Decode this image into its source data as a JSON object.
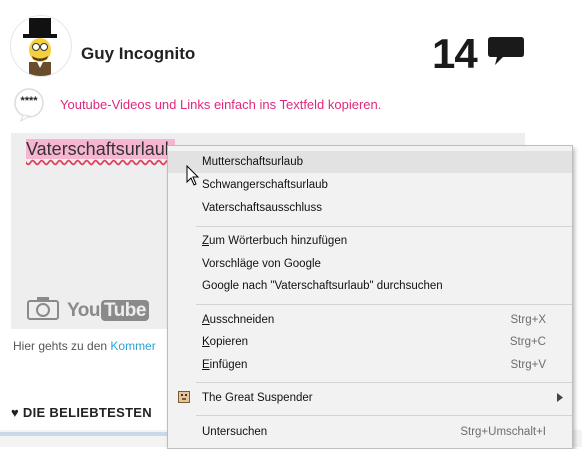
{
  "profile": {
    "username": "Guy Incognito",
    "comment_count": "14",
    "avatar_icon": "cartoon-avatar-top-hat"
  },
  "hint": {
    "stars": "****",
    "text": "Youtube-Videos und Links einfach ins Textfeld kopieren."
  },
  "editor": {
    "value": "Vaterschaftsurlaub"
  },
  "toolbar": {
    "camera_icon": "camera-icon",
    "youtube_word": "You",
    "youtube_tube": "Tube"
  },
  "footer": {
    "prefix": "Hier gehts zu den ",
    "link": "Kommer"
  },
  "popular": {
    "heading": "♥ DIE BELIEBTESTEN"
  },
  "context_menu": {
    "suggestions": [
      "Mutterschaftsurlaub",
      "Schwangerschaftsurlaub",
      "Vaterschaftsausschluss"
    ],
    "dictionary": "Zum Wörterbuch hinzufügen",
    "google_suggestions": "Vorschläge von Google",
    "google_search": "Google nach \"Vaterschaftsurlaub\" durchsuchen",
    "cut": "Ausschneiden",
    "cut_shortcut": "Strg+X",
    "copy": "Kopieren",
    "copy_shortcut": "Strg+C",
    "paste": "Einfügen",
    "paste_shortcut": "Strg+V",
    "extension": "The Great Suspender",
    "inspect": "Untersuchen",
    "inspect_shortcut": "Strg+Umschalt+I"
  },
  "colors": {
    "hint_text": "#e0287d",
    "link": "#2aa3d6",
    "spell_highlight": "#f7b5d2"
  }
}
